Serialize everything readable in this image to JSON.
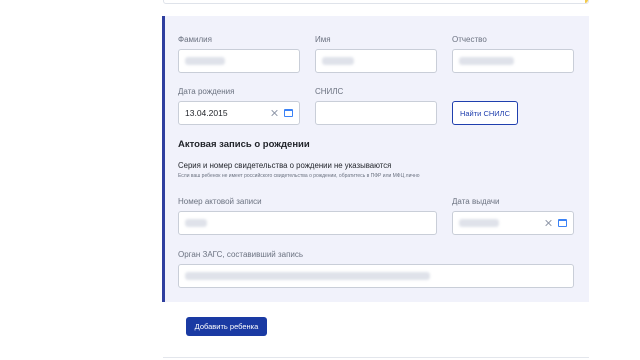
{
  "colors": {
    "accent_border": "#2f3f9f",
    "panel_bg": "#f1f2fb",
    "primary": "#1a3aa3",
    "warning_strip": "#f2c94c"
  },
  "fields": {
    "surname": {
      "label": "Фамилия",
      "value": ""
    },
    "name": {
      "label": "Имя",
      "value": ""
    },
    "patronymic": {
      "label": "Отчество",
      "value": ""
    },
    "birth_date": {
      "label": "Дата рождения",
      "value": "13.04.2015"
    },
    "snils": {
      "label": "СНИЛС",
      "value": ""
    },
    "record_number": {
      "label": "Номер актовой записи",
      "value": ""
    },
    "issue_date": {
      "label": "Дата выдачи",
      "value": ""
    },
    "registry_office": {
      "label": "Орган ЗАГС, составивший запись",
      "value": ""
    }
  },
  "find_snils_button": "Найти СНИЛС",
  "birth_record": {
    "heading": "Актовая запись о рождении",
    "note_title": "Серия и номер свидетельства о рождении не указываются",
    "note_hint": "Если ваш ребенок не имеет российского свидетельства о рождении, обратитесь в ПФР или МФЦ лично"
  },
  "add_child_button": "Добавить ребенка",
  "icons": {
    "clear": "close-icon",
    "calendar": "calendar-icon"
  }
}
